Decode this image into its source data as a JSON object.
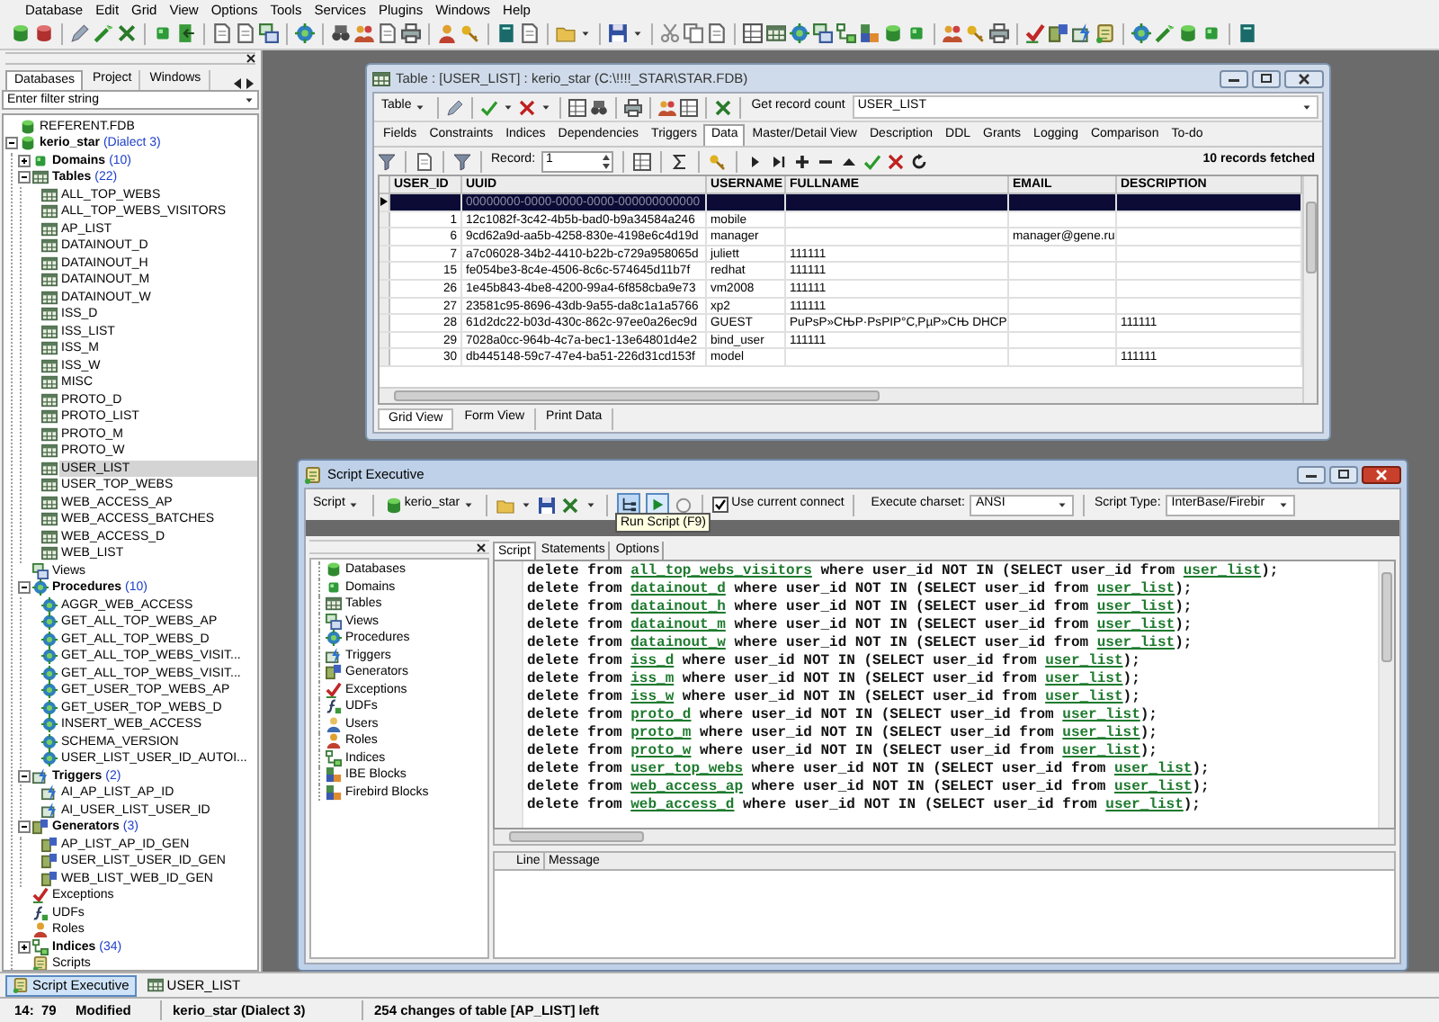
{
  "menu": [
    "Database",
    "Edit",
    "Grid",
    "View",
    "Options",
    "Tools",
    "Services",
    "Plugins",
    "Windows",
    "Help"
  ],
  "left_panel": {
    "tabs": [
      {
        "label": "Databases",
        "selected": true
      },
      {
        "label": "Project",
        "selected": false
      },
      {
        "label": "Windows",
        "selected": false
      }
    ],
    "filter": {
      "placeholder": "Enter filter string"
    },
    "tree": [
      {
        "label": "REFERENT.FDB",
        "kind": "database",
        "selected": false
      },
      {
        "label": "kerio_star",
        "count": "(Dialect 3)",
        "kind": "database",
        "selected": false,
        "expanded": true,
        "children": [
          {
            "label": "Domains",
            "count": "(10)",
            "kind": "domain",
            "selected": false,
            "expanded": false
          },
          {
            "label": "Tables",
            "count": "(22)",
            "kind": "table",
            "selected": false,
            "expanded": true,
            "children": [
              {
                "label": "ALL_TOP_WEBS",
                "kind": "table",
                "selected": false
              },
              {
                "label": "ALL_TOP_WEBS_VISITORS",
                "kind": "table",
                "selected": false
              },
              {
                "label": "AP_LIST",
                "kind": "table",
                "selected": false
              },
              {
                "label": "DATAINOUT_D",
                "kind": "table",
                "selected": false
              },
              {
                "label": "DATAINOUT_H",
                "kind": "table",
                "selected": false
              },
              {
                "label": "DATAINOUT_M",
                "kind": "table",
                "selected": false
              },
              {
                "label": "DATAINOUT_W",
                "kind": "table",
                "selected": false
              },
              {
                "label": "ISS_D",
                "kind": "table",
                "selected": false
              },
              {
                "label": "ISS_LIST",
                "kind": "table",
                "selected": false
              },
              {
                "label": "ISS_M",
                "kind": "table",
                "selected": false
              },
              {
                "label": "ISS_W",
                "kind": "table",
                "selected": false
              },
              {
                "label": "MISC",
                "kind": "table",
                "selected": false
              },
              {
                "label": "PROTO_D",
                "kind": "table",
                "selected": false
              },
              {
                "label": "PROTO_LIST",
                "kind": "table",
                "selected": false
              },
              {
                "label": "PROTO_M",
                "kind": "table",
                "selected": false
              },
              {
                "label": "PROTO_W",
                "kind": "table",
                "selected": false
              },
              {
                "label": "USER_LIST",
                "kind": "table",
                "selected": true
              },
              {
                "label": "USER_TOP_WEBS",
                "kind": "table",
                "selected": false
              },
              {
                "label": "WEB_ACCESS_AP",
                "kind": "table",
                "selected": false
              },
              {
                "label": "WEB_ACCESS_BATCHES",
                "kind": "table",
                "selected": false
              },
              {
                "label": "WEB_ACCESS_D",
                "kind": "table",
                "selected": false
              },
              {
                "label": "WEB_LIST",
                "kind": "table",
                "selected": false
              }
            ]
          },
          {
            "label": "Views",
            "kind": "view",
            "selected": false
          },
          {
            "label": "Procedures",
            "count": "(10)",
            "kind": "procedure",
            "selected": false,
            "expanded": true,
            "children": [
              {
                "label": "AGGR_WEB_ACCESS",
                "kind": "procedure",
                "selected": false
              },
              {
                "label": "GET_ALL_TOP_WEBS_AP",
                "kind": "procedure",
                "selected": false
              },
              {
                "label": "GET_ALL_TOP_WEBS_D",
                "kind": "procedure",
                "selected": false
              },
              {
                "label": "GET_ALL_TOP_WEBS_VISIT...",
                "kind": "procedure",
                "selected": false
              },
              {
                "label": "GET_ALL_TOP_WEBS_VISIT...",
                "kind": "procedure",
                "selected": false
              },
              {
                "label": "GET_USER_TOP_WEBS_AP",
                "kind": "procedure",
                "selected": false
              },
              {
                "label": "GET_USER_TOP_WEBS_D",
                "kind": "procedure",
                "selected": false
              },
              {
                "label": "INSERT_WEB_ACCESS",
                "kind": "procedure",
                "selected": false
              },
              {
                "label": "SCHEMA_VERSION",
                "kind": "procedure",
                "selected": false
              },
              {
                "label": "USER_LIST_USER_ID_AUTOI...",
                "kind": "procedure",
                "selected": false
              }
            ]
          },
          {
            "label": "Triggers",
            "count": "(2)",
            "kind": "trigger",
            "selected": false,
            "expanded": true,
            "children": [
              {
                "label": "AI_AP_LIST_AP_ID",
                "kind": "trigger",
                "selected": false
              },
              {
                "label": "AI_USER_LIST_USER_ID",
                "kind": "trigger",
                "selected": false
              }
            ]
          },
          {
            "label": "Generators",
            "count": "(3)",
            "kind": "generator",
            "selected": false,
            "expanded": true,
            "children": [
              {
                "label": "AP_LIST_AP_ID_GEN",
                "kind": "generator",
                "selected": false
              },
              {
                "label": "USER_LIST_USER_ID_GEN",
                "kind": "generator",
                "selected": false
              },
              {
                "label": "WEB_LIST_WEB_ID_GEN",
                "kind": "generator",
                "selected": false
              }
            ]
          },
          {
            "label": "Exceptions",
            "kind": "exception",
            "selected": false
          },
          {
            "label": "UDFs",
            "kind": "udf",
            "selected": false
          },
          {
            "label": "Roles",
            "kind": "role",
            "selected": false
          },
          {
            "label": "Indices",
            "count": "(34)",
            "kind": "index",
            "selected": false,
            "expanded": false
          },
          {
            "label": "Scripts",
            "kind": "script",
            "selected": false
          }
        ]
      }
    ]
  },
  "table_window": {
    "title": "Table : [USER_LIST] : kerio_star (C:\\!!!!_STAR\\STAR.FDB)",
    "active": false,
    "toolbar": {
      "menu": "Table",
      "button": "Get record count",
      "object": "USER_LIST"
    },
    "tabs": [
      {
        "label": "Fields",
        "selected": false
      },
      {
        "label": "Constraints",
        "selected": false
      },
      {
        "label": "Indices",
        "selected": false
      },
      {
        "label": "Dependencies",
        "selected": false
      },
      {
        "label": "Triggers",
        "selected": false
      },
      {
        "label": "Data",
        "selected": true
      },
      {
        "label": "Master/Detail View",
        "selected": false
      },
      {
        "label": "Description",
        "selected": false
      },
      {
        "label": "DDL",
        "selected": false
      },
      {
        "label": "Grants",
        "selected": false
      },
      {
        "label": "Logging",
        "selected": false
      },
      {
        "label": "Comparison",
        "selected": false
      },
      {
        "label": "To-do",
        "selected": false
      }
    ],
    "record_label": "Record:",
    "record": "1",
    "fetched": "10 records fetched",
    "columns": [
      "USER_ID",
      "UUID",
      "USERNAME",
      "FULLNAME",
      "EMAIL",
      "DESCRIPTION"
    ],
    "rows": [
      {
        "uuid": "00000000-0000-0000-0000-000000000000",
        "selected": true
      },
      {
        "user_id": "1",
        "uuid": "12c1082f-3c42-4b5b-bad0-b9a34584a246",
        "username": "mobile",
        "selected": false
      },
      {
        "user_id": "6",
        "uuid": "9cd62a9d-aa5b-4258-830e-4198e6c4d19d",
        "username": "manager",
        "email": "manager@gene.ru",
        "selected": false
      },
      {
        "user_id": "7",
        "uuid": "a7c06028-34b2-4410-b22b-c729a958065d",
        "username": "juliett",
        "fullname": "111111",
        "selected": false
      },
      {
        "user_id": "15",
        "uuid": "fe054be3-8c4e-4506-8c6c-574645d11b7f",
        "username": "redhat",
        "fullname": "111111",
        "selected": false
      },
      {
        "user_id": "26",
        "uuid": "1e45b843-4be8-4200-99a4-6f858cba9e73",
        "username": "vm2008",
        "fullname": "111111",
        "selected": false
      },
      {
        "user_id": "27",
        "uuid": "23581c95-8696-43db-9a55-da8c1a1a5766",
        "username": "xp2",
        "fullname": "111111",
        "selected": false
      },
      {
        "user_id": "28",
        "uuid": "61d2dc22-b03d-430c-862c-97ee0a26ec9d",
        "username": "GUEST",
        "fullname": "PuPsP»CЊP·PsPIP°C‚PµP»CЊ DHCP",
        "description": "111111",
        "selected": false
      },
      {
        "user_id": "29",
        "uuid": "7028a0cc-964b-4c7a-bec1-13e64801d4e2",
        "username": "bind_user",
        "fullname": "111111",
        "selected": false
      },
      {
        "user_id": "30",
        "uuid": "db445148-59c7-47e4-ba51-226d31cd153f",
        "username": "model",
        "description": "111111",
        "selected": false
      }
    ],
    "view_tabs": [
      {
        "label": "Grid View",
        "selected": true
      },
      {
        "label": "Form View",
        "selected": false
      },
      {
        "label": "Print Data",
        "selected": false
      }
    ]
  },
  "script_window": {
    "title": "Script Executive",
    "active": true,
    "toolbar": {
      "menu": "Script",
      "database": "kerio_star",
      "use_current_connect": {
        "label": "Use current connect",
        "checked": true
      },
      "charset_label": "Execute charset:",
      "charset": "ANSI",
      "script_type_label": "Script Type:",
      "script_type": "InterBase/Firebir"
    },
    "tooltip": "Run Script (F9)",
    "objects": [
      {
        "label": "Databases",
        "kind": "database"
      },
      {
        "label": "Domains",
        "kind": "domain"
      },
      {
        "label": "Tables",
        "kind": "table"
      },
      {
        "label": "Views",
        "kind": "view"
      },
      {
        "label": "Procedures",
        "kind": "procedure"
      },
      {
        "label": "Triggers",
        "kind": "trigger"
      },
      {
        "label": "Generators",
        "kind": "generator"
      },
      {
        "label": "Exceptions",
        "kind": "exception"
      },
      {
        "label": "UDFs",
        "kind": "udf"
      },
      {
        "label": "Users",
        "kind": "user"
      },
      {
        "label": "Roles",
        "kind": "role"
      },
      {
        "label": "Indices",
        "kind": "index"
      },
      {
        "label": "IBE Blocks",
        "kind": "block"
      },
      {
        "label": "Firebird Blocks",
        "kind": "block"
      }
    ],
    "tabs": [
      {
        "label": "Script",
        "selected": true
      },
      {
        "label": "Statements",
        "selected": false
      },
      {
        "label": "Options",
        "selected": false
      }
    ],
    "code_lines": [
      [
        {
          "kind": "plain",
          "text": "delete from "
        },
        {
          "kind": "object",
          "text": "all_top_webs_visitors"
        },
        {
          "kind": "plain",
          "text": " where user_id NOT IN (SELECT user_id from "
        },
        {
          "kind": "object",
          "text": "user_list"
        },
        {
          "kind": "plain",
          "text": ");"
        }
      ],
      [
        {
          "kind": "plain",
          "text": "delete from "
        },
        {
          "kind": "object",
          "text": "datainout_d"
        },
        {
          "kind": "plain",
          "text": " where user_id NOT IN (SELECT user_id from "
        },
        {
          "kind": "object",
          "text": "user_list"
        },
        {
          "kind": "plain",
          "text": ");"
        }
      ],
      [
        {
          "kind": "plain",
          "text": "delete from "
        },
        {
          "kind": "object",
          "text": "datainout_h"
        },
        {
          "kind": "plain",
          "text": " where user_id NOT IN (SELECT user_id from "
        },
        {
          "kind": "object",
          "text": "user_list"
        },
        {
          "kind": "plain",
          "text": ");"
        }
      ],
      [
        {
          "kind": "plain",
          "text": "delete from "
        },
        {
          "kind": "object",
          "text": "datainout_m"
        },
        {
          "kind": "plain",
          "text": " where user_id NOT IN (SELECT user_id from "
        },
        {
          "kind": "object",
          "text": "user_list"
        },
        {
          "kind": "plain",
          "text": ");"
        }
      ],
      [
        {
          "kind": "plain",
          "text": "delete from "
        },
        {
          "kind": "object",
          "text": "datainout_w"
        },
        {
          "kind": "plain",
          "text": " where user_id NOT IN (SELECT user_id from "
        },
        {
          "kind": "object",
          "text": "user_list"
        },
        {
          "kind": "plain",
          "text": ");"
        }
      ],
      [
        {
          "kind": "plain",
          "text": "delete from "
        },
        {
          "kind": "object",
          "text": "iss_d"
        },
        {
          "kind": "plain",
          "text": " where user_id NOT IN (SELECT user_id from "
        },
        {
          "kind": "object",
          "text": "user_list"
        },
        {
          "kind": "plain",
          "text": ");"
        }
      ],
      [
        {
          "kind": "plain",
          "text": "delete from "
        },
        {
          "kind": "object",
          "text": "iss_m"
        },
        {
          "kind": "plain",
          "text": " where user_id NOT IN (SELECT user_id from "
        },
        {
          "kind": "object",
          "text": "user_list"
        },
        {
          "kind": "plain",
          "text": ");"
        }
      ],
      [
        {
          "kind": "plain",
          "text": "delete from "
        },
        {
          "kind": "object",
          "text": "iss_w"
        },
        {
          "kind": "plain",
          "text": " where user_id NOT IN (SELECT user_id from "
        },
        {
          "kind": "object",
          "text": "user_list"
        },
        {
          "kind": "plain",
          "text": ");"
        }
      ],
      [
        {
          "kind": "plain",
          "text": "delete from "
        },
        {
          "kind": "object",
          "text": "proto_d"
        },
        {
          "kind": "plain",
          "text": " where user_id NOT IN (SELECT user_id from "
        },
        {
          "kind": "object",
          "text": "user_list"
        },
        {
          "kind": "plain",
          "text": ");"
        }
      ],
      [
        {
          "kind": "plain",
          "text": "delete from "
        },
        {
          "kind": "object",
          "text": "proto_m"
        },
        {
          "kind": "plain",
          "text": " where user_id NOT IN (SELECT user_id from "
        },
        {
          "kind": "object",
          "text": "user_list"
        },
        {
          "kind": "plain",
          "text": ");"
        }
      ],
      [
        {
          "kind": "plain",
          "text": "delete from "
        },
        {
          "kind": "object",
          "text": "proto_w"
        },
        {
          "kind": "plain",
          "text": " where user_id NOT IN (SELECT user_id from "
        },
        {
          "kind": "object",
          "text": "user_list"
        },
        {
          "kind": "plain",
          "text": ");"
        }
      ],
      [
        {
          "kind": "plain",
          "text": "delete from "
        },
        {
          "kind": "object",
          "text": "user_top_webs"
        },
        {
          "kind": "plain",
          "text": " where user_id NOT IN (SELECT user_id from "
        },
        {
          "kind": "object",
          "text": "user_list"
        },
        {
          "kind": "plain",
          "text": ");"
        }
      ],
      [
        {
          "kind": "plain",
          "text": "delete from "
        },
        {
          "kind": "object",
          "text": "web_access_ap"
        },
        {
          "kind": "plain",
          "text": " where user_id NOT IN (SELECT user_id from "
        },
        {
          "kind": "object",
          "text": "user_list"
        },
        {
          "kind": "plain",
          "text": ");"
        }
      ],
      [
        {
          "kind": "plain",
          "text": "delete from "
        },
        {
          "kind": "object",
          "text": "web_access_d"
        },
        {
          "kind": "plain",
          "text": " where user_id NOT IN (SELECT user_id from "
        },
        {
          "kind": "object",
          "text": "user_list"
        },
        {
          "kind": "plain",
          "text": ");"
        }
      ]
    ],
    "message_columns": [
      "Line",
      "Message"
    ]
  },
  "taskbar": [
    {
      "label": "Script Executive",
      "kind": "script",
      "selected": true
    },
    {
      "label": "USER_LIST",
      "kind": "table",
      "selected": false
    }
  ],
  "status_bar": {
    "position": "14:  79",
    "state": "Modified",
    "database": "kerio_star (Dialect 3)",
    "message": "254 changes of table [AP_LIST] left"
  }
}
